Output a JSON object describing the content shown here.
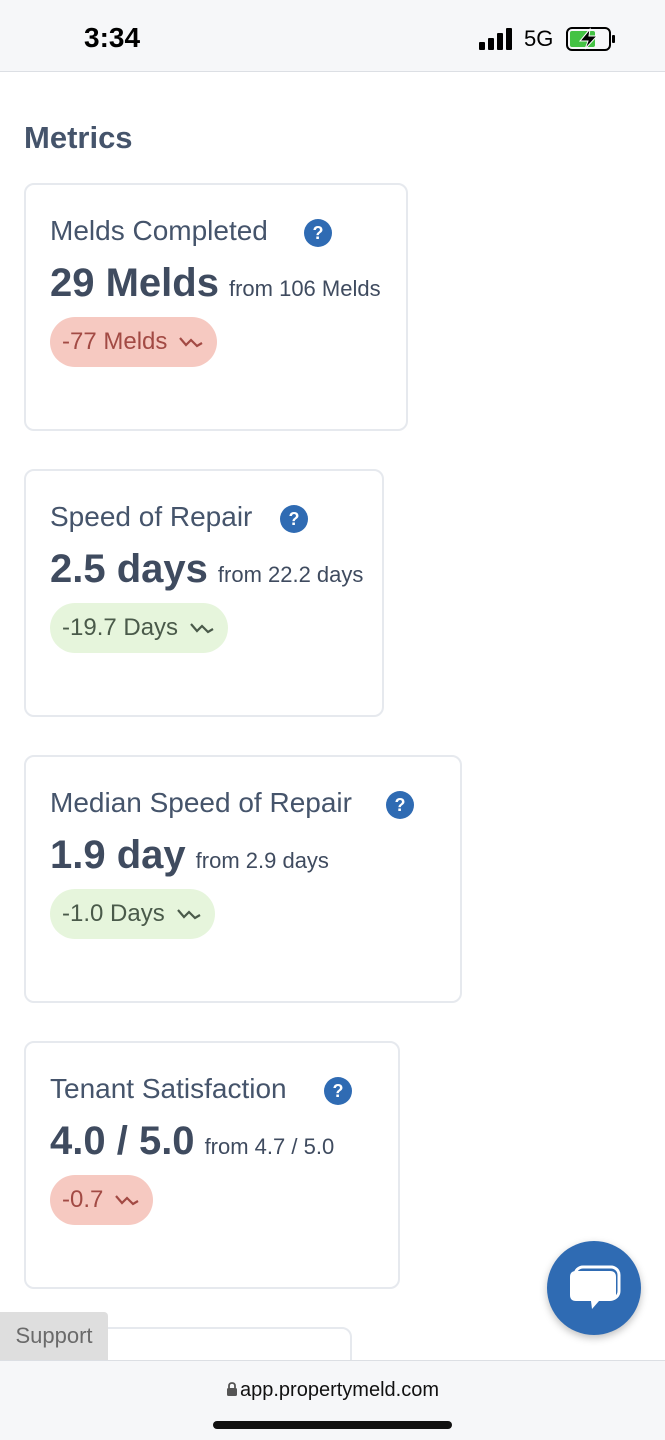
{
  "status_bar": {
    "time": "3:34",
    "network": "5G"
  },
  "page_title": "Metrics",
  "cards": [
    {
      "title": "Melds Completed",
      "value": "29 Melds",
      "from": "from 106 Melds",
      "delta": "-77 Melds",
      "delta_status": "negative"
    },
    {
      "title": "Speed of Repair",
      "value": "2.5 days",
      "from": "from 22.2 days",
      "delta": "-19.7 Days",
      "delta_status": "positive"
    },
    {
      "title": "Median Speed of Repair",
      "value": "1.9 day",
      "from": "from 2.9 days",
      "delta": "-1.0 Days",
      "delta_status": "positive"
    },
    {
      "title": "Tenant Satisfaction",
      "value": "4.0 / 5.0",
      "from": "from 4.7 / 5.0",
      "delta": "-0.7",
      "delta_status": "negative"
    }
  ],
  "help_label": "?",
  "support_label": "Support",
  "browser": {
    "url": "app.propertymeld.com"
  },
  "colors": {
    "accent": "#2f6bb3",
    "negative_bg": "#f6c9c1",
    "positive_bg": "#e6f5dc"
  }
}
